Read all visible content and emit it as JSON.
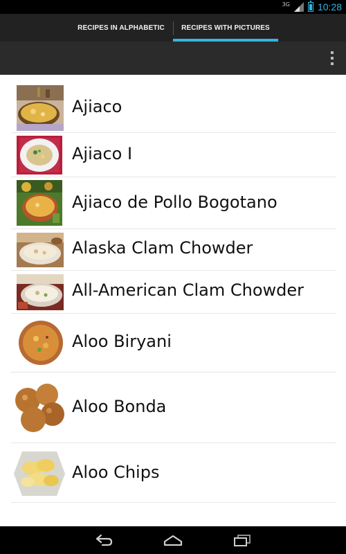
{
  "status_bar": {
    "network": "3G",
    "time": "10:28"
  },
  "tabs": [
    {
      "label": "RECIPES IN ALPHABETIC",
      "selected": false
    },
    {
      "label": "RECIPES WITH PICTURES",
      "selected": true
    }
  ],
  "accent_color": "#33b5e5",
  "action_bar": {
    "overflow_icon": "overflow-menu-icon"
  },
  "recipes": [
    {
      "name": "Ajiaco",
      "thumb": "ajiaco-photo"
    },
    {
      "name": "Ajiaco I",
      "thumb": "ajiaco-i-photo"
    },
    {
      "name": "Ajiaco de Pollo Bogotano",
      "thumb": "ajiaco-de-pollo-photo"
    },
    {
      "name": "Alaska Clam Chowder",
      "thumb": "alaska-clam-chowder-photo"
    },
    {
      "name": "All-American Clam Chowder",
      "thumb": "all-american-clam-chowder-photo"
    },
    {
      "name": "Aloo Biryani",
      "thumb": "aloo-biryani-photo"
    },
    {
      "name": "Aloo Bonda",
      "thumb": "aloo-bonda-photo"
    },
    {
      "name": "Aloo Chips",
      "thumb": "aloo-chips-photo"
    }
  ],
  "nav_bar": {
    "back_icon": "back-icon",
    "home_icon": "home-icon",
    "recents_icon": "recent-apps-icon"
  }
}
